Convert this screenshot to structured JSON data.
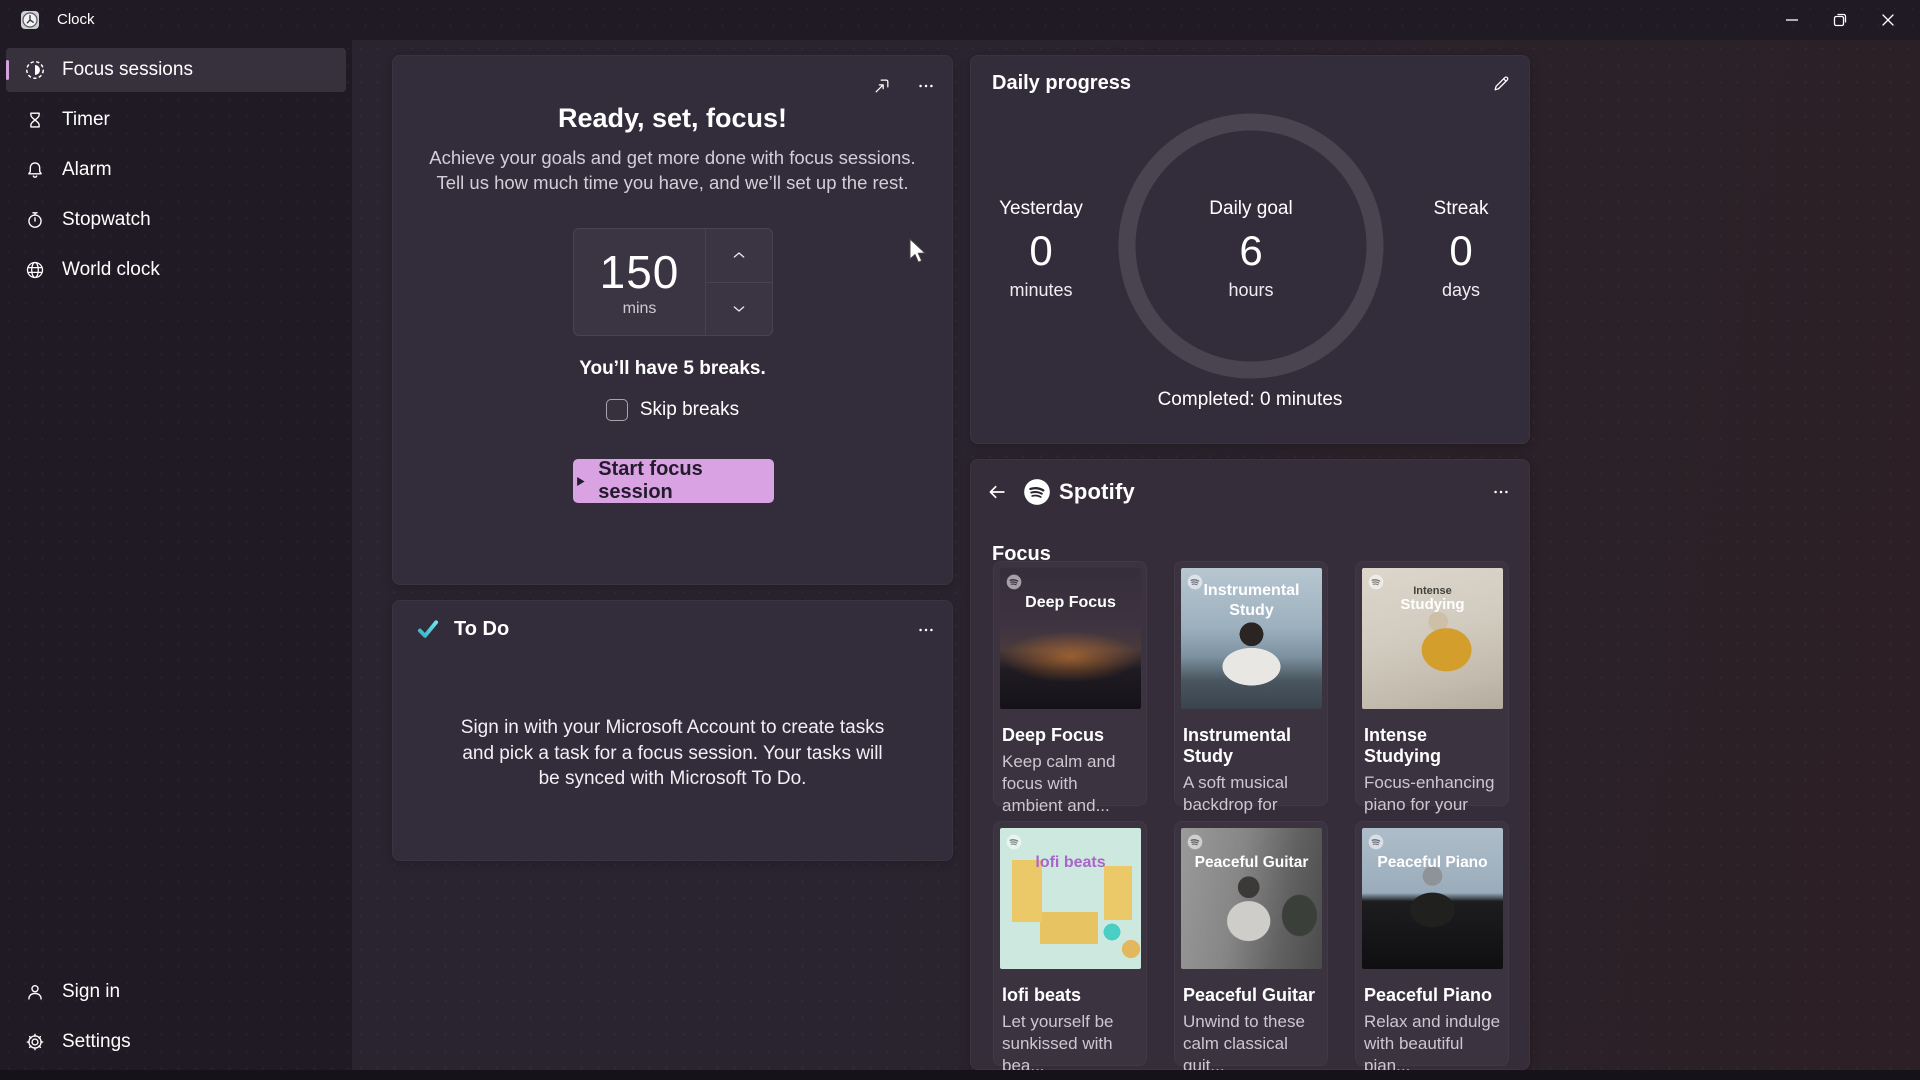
{
  "titlebar": {
    "app_title": "Clock",
    "controls": [
      "minimize",
      "restore",
      "close"
    ]
  },
  "sidebar": {
    "items": [
      {
        "label": "Focus sessions",
        "selected": true
      },
      {
        "label": "Timer",
        "selected": false
      },
      {
        "label": "Alarm",
        "selected": false
      },
      {
        "label": "Stopwatch",
        "selected": false
      },
      {
        "label": "World clock",
        "selected": false
      }
    ],
    "bottom": [
      {
        "label": "Sign in"
      },
      {
        "label": "Settings"
      }
    ]
  },
  "focus_card": {
    "title": "Ready, set, focus!",
    "subtitle": "Achieve your goals and get more done with focus sessions. Tell us how much time you have, and we’ll set up the rest.",
    "minutes_value": "150",
    "minutes_unit": "mins",
    "breaks_text": "You’ll have 5 breaks.",
    "skip_breaks_label": "Skip breaks",
    "skip_breaks_checked": false,
    "start_button_label": "Start focus session"
  },
  "todo_card": {
    "title": "To Do",
    "body": "Sign in with your Microsoft Account to create tasks and pick a task for a focus session. Your tasks will be synced with Microsoft To Do."
  },
  "daily_progress": {
    "title": "Daily progress",
    "stats": [
      {
        "label": "Yesterday",
        "value": "0",
        "unit": "minutes"
      },
      {
        "label": "Daily goal",
        "value": "6",
        "unit": "hours"
      },
      {
        "label": "Streak",
        "value": "0",
        "unit": "days"
      }
    ],
    "completed_text": "Completed: 0 minutes"
  },
  "spotify": {
    "brand": "Spotify",
    "section_title": "Focus",
    "playlists": [
      {
        "name": "Deep Focus",
        "desc": "Keep calm and focus with ambient and...",
        "art_lines": [
          "Deep Focus"
        ]
      },
      {
        "name": "Instrumental Study",
        "desc": "A soft musical backdrop for your...",
        "art_lines": [
          "Instrumental",
          "Study"
        ]
      },
      {
        "name": "Intense Studying",
        "desc": "Focus-enhancing piano for your stu...",
        "art_lines": [
          "Intense",
          "Studying"
        ]
      },
      {
        "name": "lofi beats",
        "desc": "Let yourself be sunkissed with bea...",
        "art_lines": [
          "lofi beats"
        ]
      },
      {
        "name": "Peaceful Guitar",
        "desc": "Unwind to these calm classical guit...",
        "art_lines": [
          "Peaceful Guitar"
        ]
      },
      {
        "name": "Peaceful Piano",
        "desc": "Relax and indulge with beautiful pian...",
        "art_lines": [
          "Peaceful Piano"
        ]
      }
    ]
  },
  "colors": {
    "accent": "#d9a2e3",
    "todo_check": "#4cc8dc",
    "ring": "#4a4450"
  }
}
